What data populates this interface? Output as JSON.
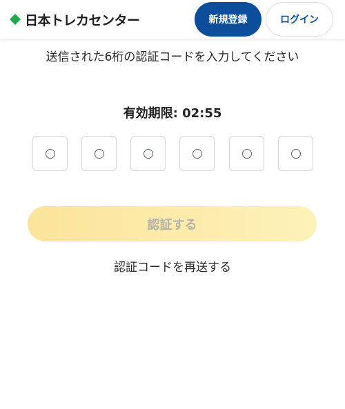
{
  "header": {
    "logo_text": "日本トレカセンター",
    "signup_label": "新規登録",
    "login_label": "ログイン"
  },
  "colors": {
    "brand_green": "#1fa94a",
    "primary_blue": "#0d4e9c",
    "verify_yellow": "#fbe49b"
  },
  "main": {
    "instruction": "送信された6桁の認証コードを入力してください",
    "expiry": "有効期限: 02:55",
    "code_boxes": [
      {
        "placeholder": "○"
      },
      {
        "placeholder": "○"
      },
      {
        "placeholder": "○"
      },
      {
        "placeholder": "○"
      },
      {
        "placeholder": "○"
      },
      {
        "placeholder": "○"
      }
    ],
    "verify_label": "認証する",
    "resend_label": "認証コードを再送する"
  }
}
